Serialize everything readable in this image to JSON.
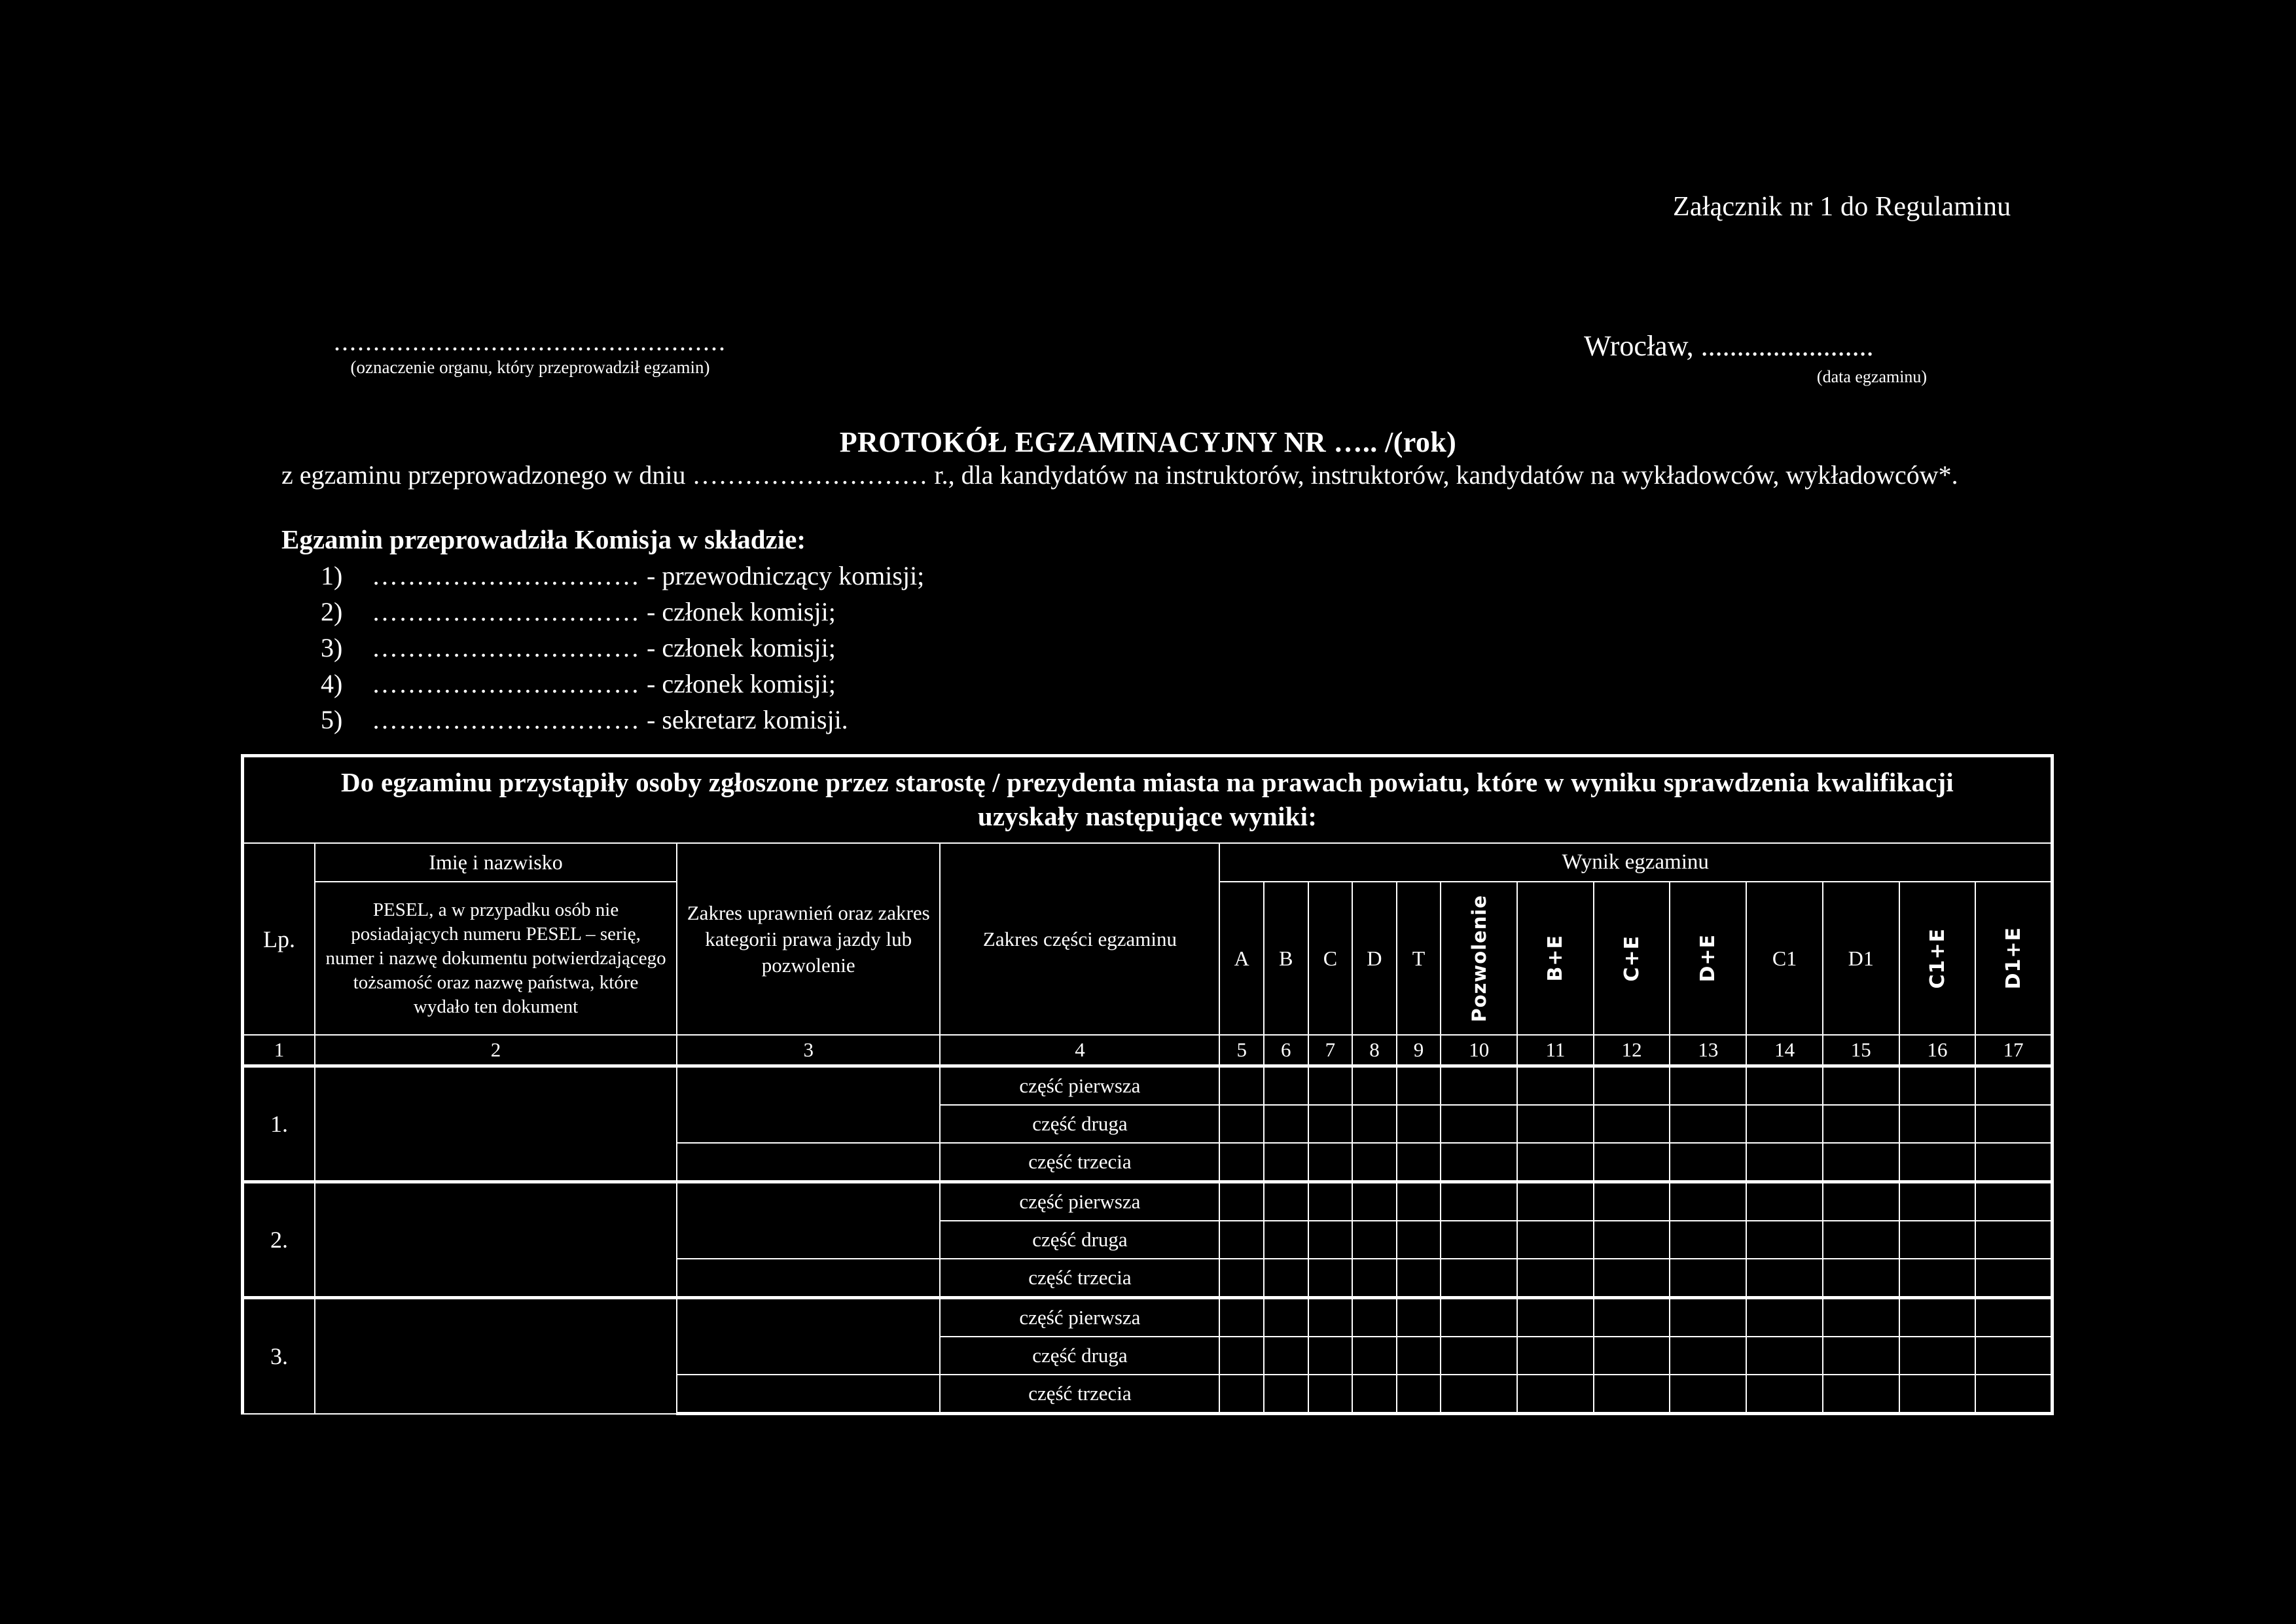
{
  "annex": {
    "text": "Załącznik nr 1 do Regulaminu"
  },
  "organ": {
    "dots": "..................................................",
    "caption": "(oznaczenie organu, który przeprowadził egzamin)"
  },
  "city": {
    "line": "Wrocław, ........................",
    "caption": "(data egzaminu)"
  },
  "title": "PROTOKÓŁ EGZAMINACYJNY NR ….. /(rok)",
  "intro": "z egzaminu przeprowadzonego w dniu ……………………… r., dla kandydatów na instruktorów, instruktorów, kandydatów na wykładowców, wykładowców*.",
  "commission": {
    "heading": "Egzamin przeprowadziła Komisja w składzie:",
    "items": [
      {
        "num": "1)",
        "dots": "…………………………",
        "role": "- przewodniczący komisji;"
      },
      {
        "num": "2)",
        "dots": "…………………………",
        "role": "- członek komisji;"
      },
      {
        "num": "3)",
        "dots": "…………………………",
        "role": "- członek komisji;"
      },
      {
        "num": "4)",
        "dots": "…………………………",
        "role": "- członek komisji;"
      },
      {
        "num": "5)",
        "dots": "…………………………",
        "role": "- sekretarz komisji."
      }
    ]
  },
  "table": {
    "banner_line1": "Do egzaminu przystąpiły osoby zgłoszone przez starostę / prezydenta miasta na prawach powiatu, które w wyniku sprawdzenia kwalifikacji",
    "banner_line2": "uzyskały następujące wyniki:",
    "headers": {
      "lp": "Lp.",
      "name": "Imię i nazwisko",
      "pesel": "PESEL, a w przypadku osób nie posiadających numeru PESEL – serię, numer i nazwę dokumentu potwierdzającego tożsamość oraz nazwę państwa, które wydało ten dokument",
      "scope": "Zakres uprawnień oraz zakres kategorii prawa jazdy lub pozwolenie",
      "part": "Zakres części egzaminu",
      "result": "Wynik egzaminu"
    },
    "categories": [
      {
        "label": "A",
        "rotated": false
      },
      {
        "label": "B",
        "rotated": false
      },
      {
        "label": "C",
        "rotated": false
      },
      {
        "label": "D",
        "rotated": false
      },
      {
        "label": "T",
        "rotated": false
      },
      {
        "label": "Pozwolenie",
        "rotated": true
      },
      {
        "label": "B+E",
        "rotated": true
      },
      {
        "label": "C+E",
        "rotated": true
      },
      {
        "label": "D+E",
        "rotated": true
      },
      {
        "label": "C1",
        "rotated": false
      },
      {
        "label": "D1",
        "rotated": false
      },
      {
        "label": "C1+E",
        "rotated": true
      },
      {
        "label": "D1+E",
        "rotated": true
      }
    ],
    "column_numbers": [
      "1",
      "2",
      "3",
      "4",
      "5",
      "6",
      "7",
      "8",
      "9",
      "10",
      "11",
      "12",
      "13",
      "14",
      "15",
      "16",
      "17"
    ],
    "rows": [
      {
        "lp": "1.",
        "name": "",
        "pesel": "",
        "scope": "",
        "parts": [
          "część pierwsza",
          "część druga",
          "część trzecia"
        ]
      },
      {
        "lp": "2.",
        "name": "",
        "pesel": "",
        "scope": "",
        "parts": [
          "część pierwsza",
          "część druga",
          "część trzecia"
        ]
      },
      {
        "lp": "3.",
        "name": "",
        "pesel": "",
        "scope": "",
        "parts": [
          "część pierwsza",
          "część druga",
          "część trzecia"
        ]
      }
    ]
  },
  "colors": {
    "background": "#000000",
    "foreground": "#ffffff"
  }
}
